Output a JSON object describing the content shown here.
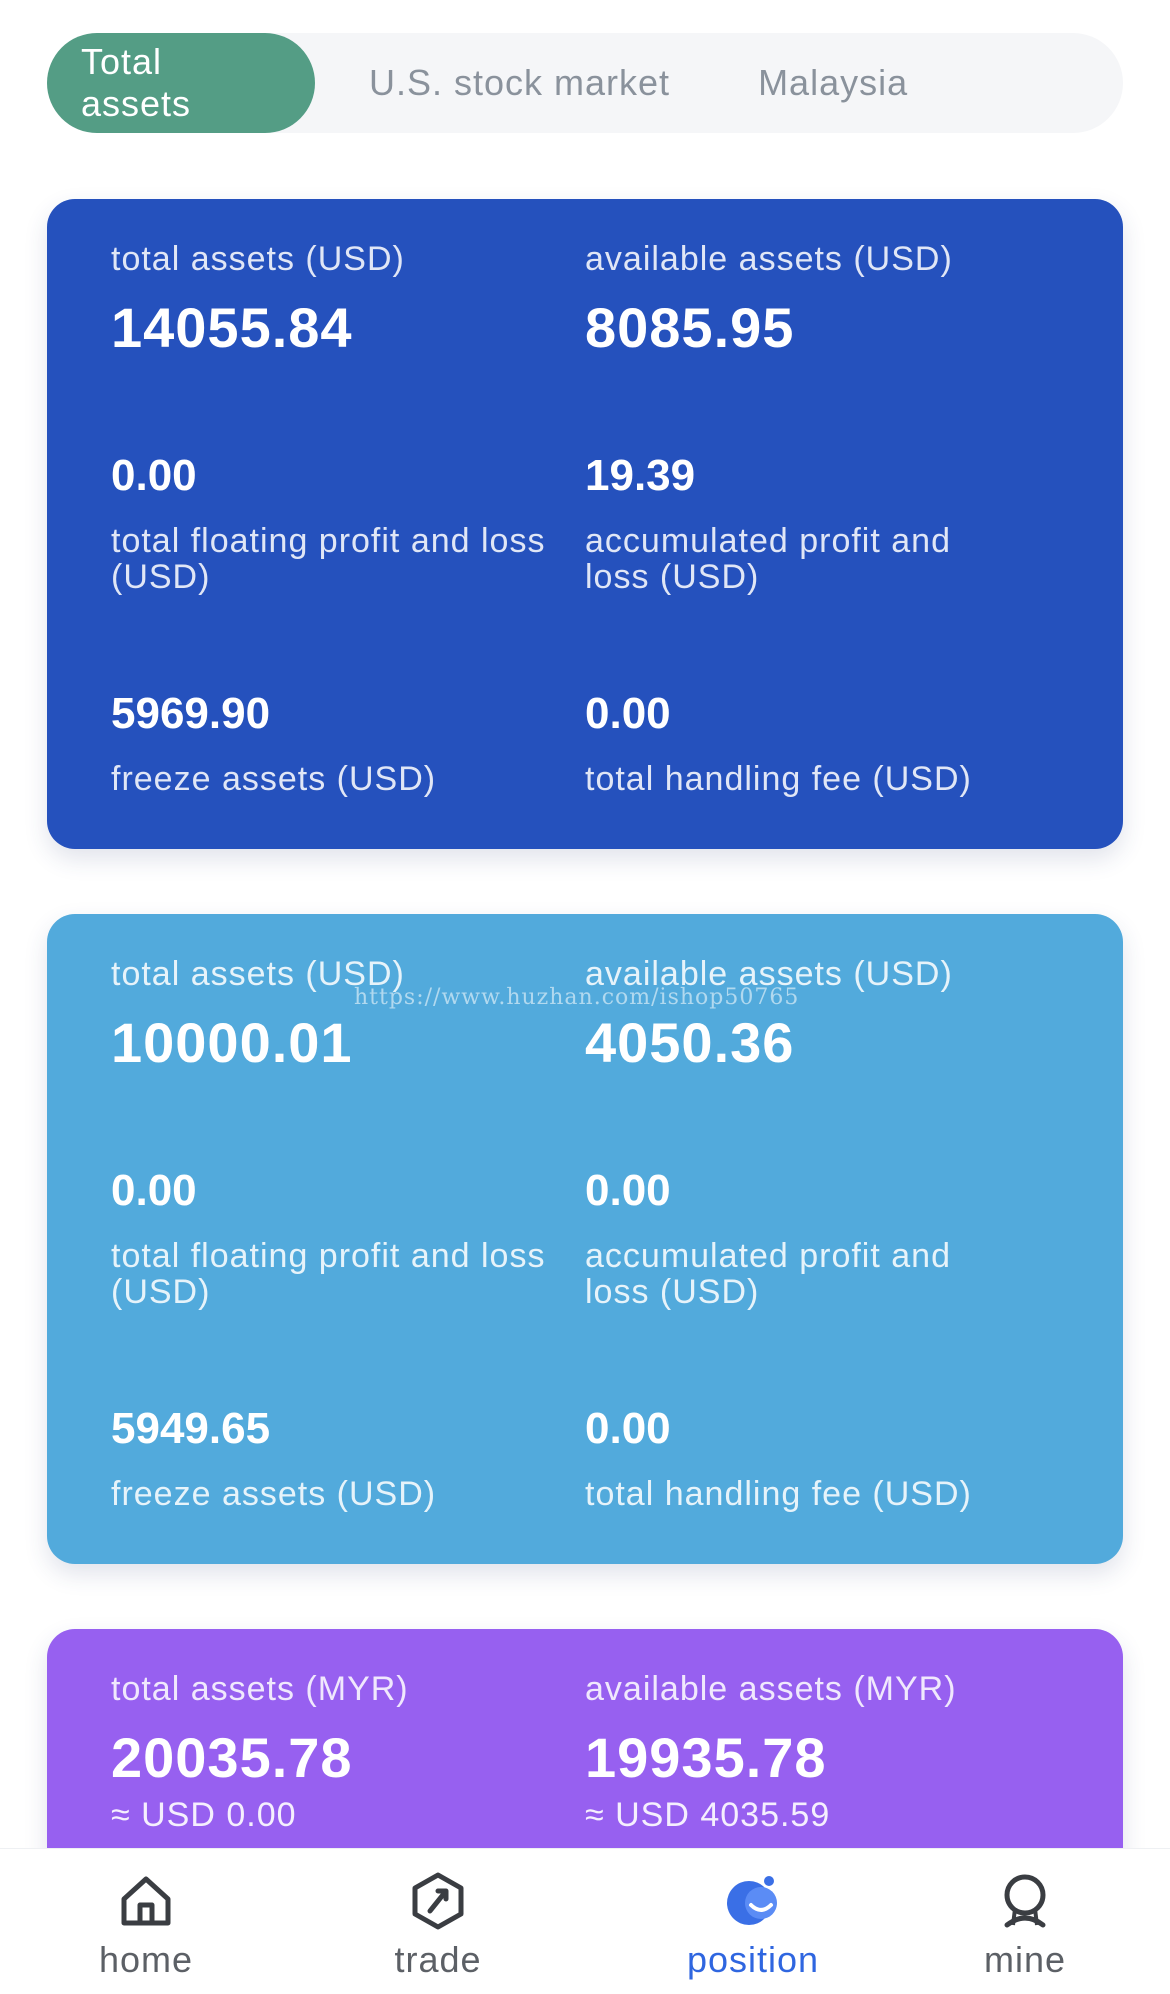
{
  "tabs": [
    {
      "label": "Total assets",
      "active": true
    },
    {
      "label": "U.S. stock market",
      "active": false
    },
    {
      "label": "Malaysia",
      "active": false
    }
  ],
  "cards": [
    {
      "color": "#2551bd",
      "total_assets_label": "total assets (USD)",
      "total_assets_value": "14055.84",
      "available_assets_label": "available assets (USD)",
      "available_assets_value": "8085.95",
      "floating_pl_value": "0.00",
      "floating_pl_label": "total floating profit and loss (USD)",
      "accumulated_pl_value": "19.39",
      "accumulated_pl_label": "accumulated profit and loss (USD)",
      "freeze_value": "5969.90",
      "freeze_label": "freeze assets (USD)",
      "fee_value": "0.00",
      "fee_label": "total handling fee (USD)"
    },
    {
      "color": "#52aadc",
      "total_assets_label": "total assets (USD)",
      "total_assets_value": "10000.01",
      "available_assets_label": "available assets (USD)",
      "available_assets_value": "4050.36",
      "floating_pl_value": "0.00",
      "floating_pl_label": "total floating profit and loss (USD)",
      "accumulated_pl_value": "0.00",
      "accumulated_pl_label": "accumulated profit and loss (USD)",
      "freeze_value": "5949.65",
      "freeze_label": "freeze assets (USD)",
      "fee_value": "0.00",
      "fee_label": "total handling fee (USD)"
    },
    {
      "color": "#9760f0",
      "total_assets_label": "total assets (MYR)",
      "total_assets_value": "20035.78",
      "total_assets_approx": "≈ USD 0.00",
      "available_assets_label": "available assets (MYR)",
      "available_assets_value": "19935.78",
      "available_assets_approx": "≈ USD 4035.59"
    }
  ],
  "watermark": "https://www.huzhan.com/ishop50765",
  "nav": [
    {
      "label": "home",
      "icon": "home-icon",
      "active": false
    },
    {
      "label": "trade",
      "icon": "trade-icon",
      "active": false
    },
    {
      "label": "position",
      "icon": "position-icon",
      "active": true
    },
    {
      "label": "mine",
      "icon": "mine-icon",
      "active": false
    }
  ],
  "colors": {
    "accent": "#549d85",
    "nav_active": "#2f66e0"
  }
}
